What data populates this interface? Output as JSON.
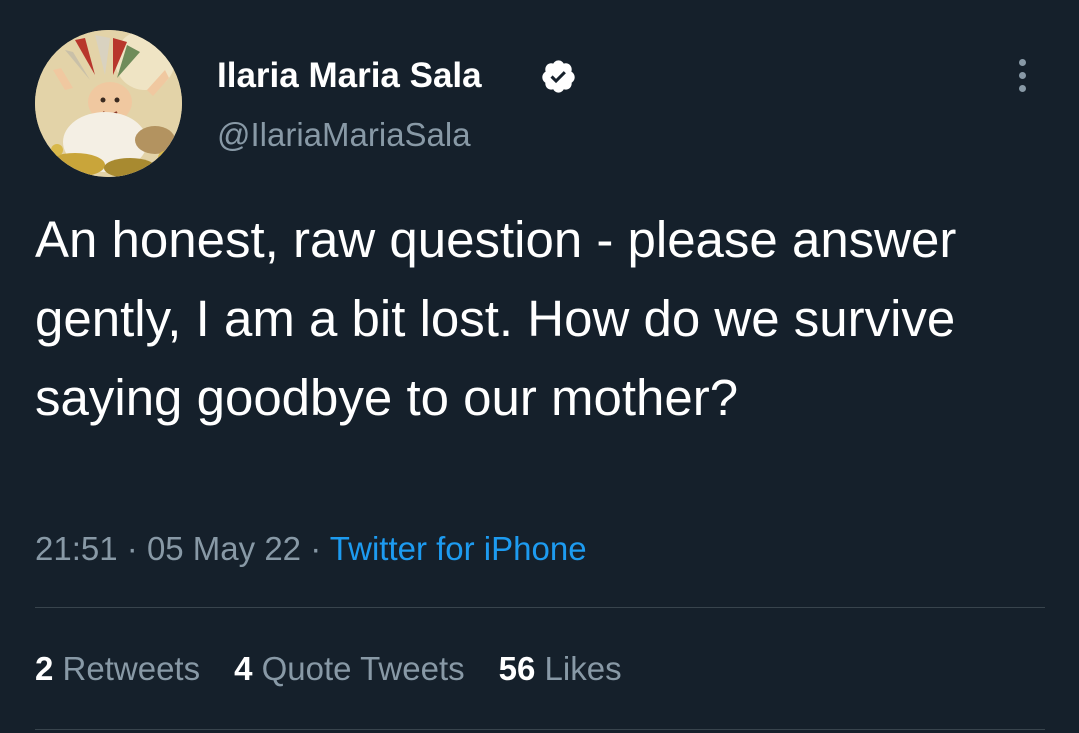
{
  "author": {
    "display_name": "Ilaria Maria Sala",
    "handle": "@IlariaMariaSala",
    "avatar_icon": "caricature-avatar",
    "verified_icon": "verified-badge-icon"
  },
  "tweet": {
    "text": "An honest, raw question - please answer gently, I am a bit lost. How do we survive saying goodbye to our mother?",
    "time": "21:51",
    "date": "05 May 22",
    "separator": "·",
    "source": "Twitter for iPhone"
  },
  "stats": {
    "retweets_count": "2",
    "retweets_label": "Retweets",
    "quotes_count": "4",
    "quotes_label": "Quote Tweets",
    "likes_count": "56",
    "likes_label": "Likes"
  },
  "colors": {
    "background": "#15202b",
    "text": "#ffffff",
    "secondary": "#8899a6",
    "link": "#1d9bf0",
    "divider": "#38444d"
  }
}
